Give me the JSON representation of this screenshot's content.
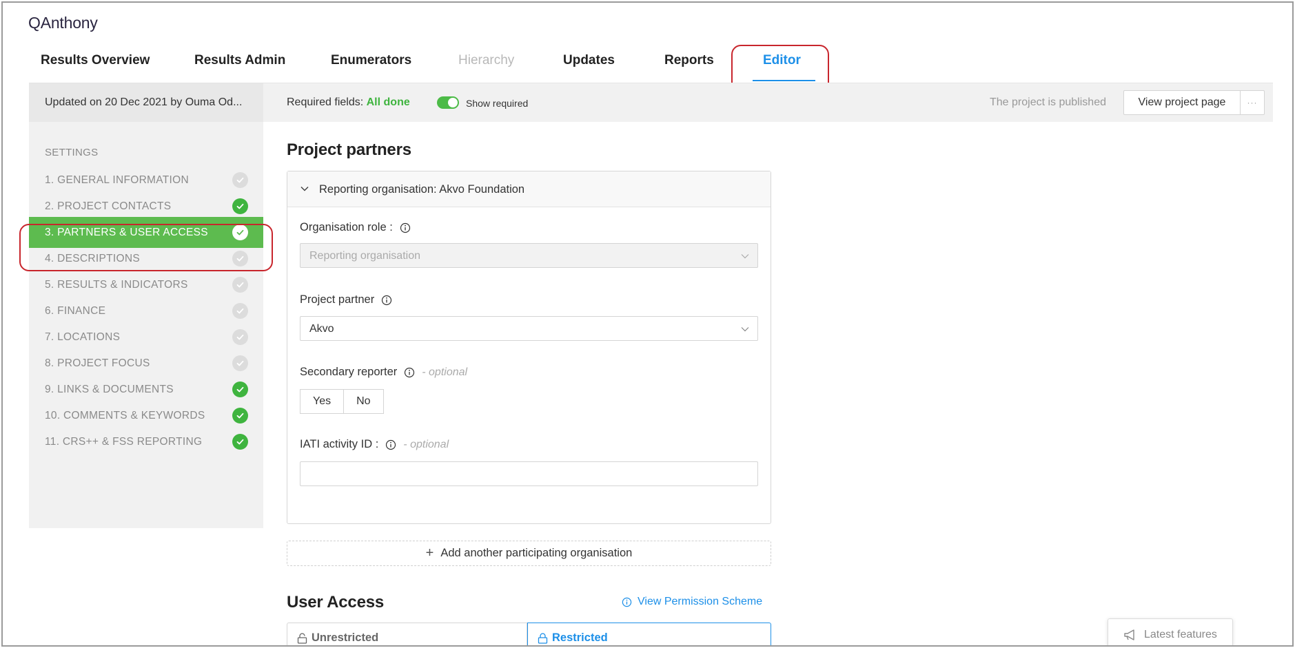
{
  "app": {
    "title": "QAnthony"
  },
  "nav": {
    "tabs": [
      {
        "label": "Results Overview",
        "state": "normal"
      },
      {
        "label": "Results Admin",
        "state": "normal"
      },
      {
        "label": "Enumerators",
        "state": "normal"
      },
      {
        "label": "Hierarchy",
        "state": "disabled"
      },
      {
        "label": "Updates",
        "state": "normal"
      },
      {
        "label": "Reports",
        "state": "normal"
      },
      {
        "label": "Editor",
        "state": "active"
      }
    ]
  },
  "topbar": {
    "updated_text": "Updated on 20 Dec 2021 by Ouma Od...",
    "required_label": "Required fields:",
    "required_value": "All done",
    "show_required_label": "Show required",
    "published_text": "The project is published",
    "view_button": "View project page",
    "more_button": "···"
  },
  "sidebar": {
    "heading": "SETTINGS",
    "items": [
      {
        "label": "1. GENERAL INFORMATION",
        "done": false
      },
      {
        "label": "2. PROJECT CONTACTS",
        "done": true
      },
      {
        "label": "3. PARTNERS & USER ACCESS",
        "done": true,
        "active": true
      },
      {
        "label": "4. DESCRIPTIONS",
        "done": false
      },
      {
        "label": "5. RESULTS & INDICATORS",
        "done": false
      },
      {
        "label": "6. FINANCE",
        "done": false
      },
      {
        "label": "7. LOCATIONS",
        "done": false
      },
      {
        "label": "8. PROJECT FOCUS",
        "done": false
      },
      {
        "label": "9. LINKS & DOCUMENTS",
        "done": true
      },
      {
        "label": "10. COMMENTS & KEYWORDS",
        "done": true
      },
      {
        "label": "11. CRS++ & FSS REPORTING",
        "done": true
      }
    ]
  },
  "main": {
    "title": "Project partners",
    "panel": {
      "header": "Reporting organisation: Akvo Foundation",
      "org_role_label": "Organisation role :",
      "org_role_value": "Reporting organisation",
      "partner_label": "Project partner",
      "partner_value": "Akvo",
      "secondary_label": "Secondary reporter",
      "optional_text": "- optional",
      "yes_label": "Yes",
      "no_label": "No",
      "iati_label": "IATI activity ID :",
      "iati_value": ""
    },
    "add_org_label": "Add another participating organisation",
    "user_access": {
      "title": "User Access",
      "permission_link": "View Permission Scheme",
      "unrestricted_label": "Unrestricted",
      "restricted_label": "Restricted"
    }
  },
  "latest_features_label": "Latest features",
  "colors": {
    "accent_blue": "#1c8fe8",
    "success_green": "#3fb43f",
    "active_sidebar": "#5dbb4f",
    "highlight_red": "#c8252c"
  }
}
